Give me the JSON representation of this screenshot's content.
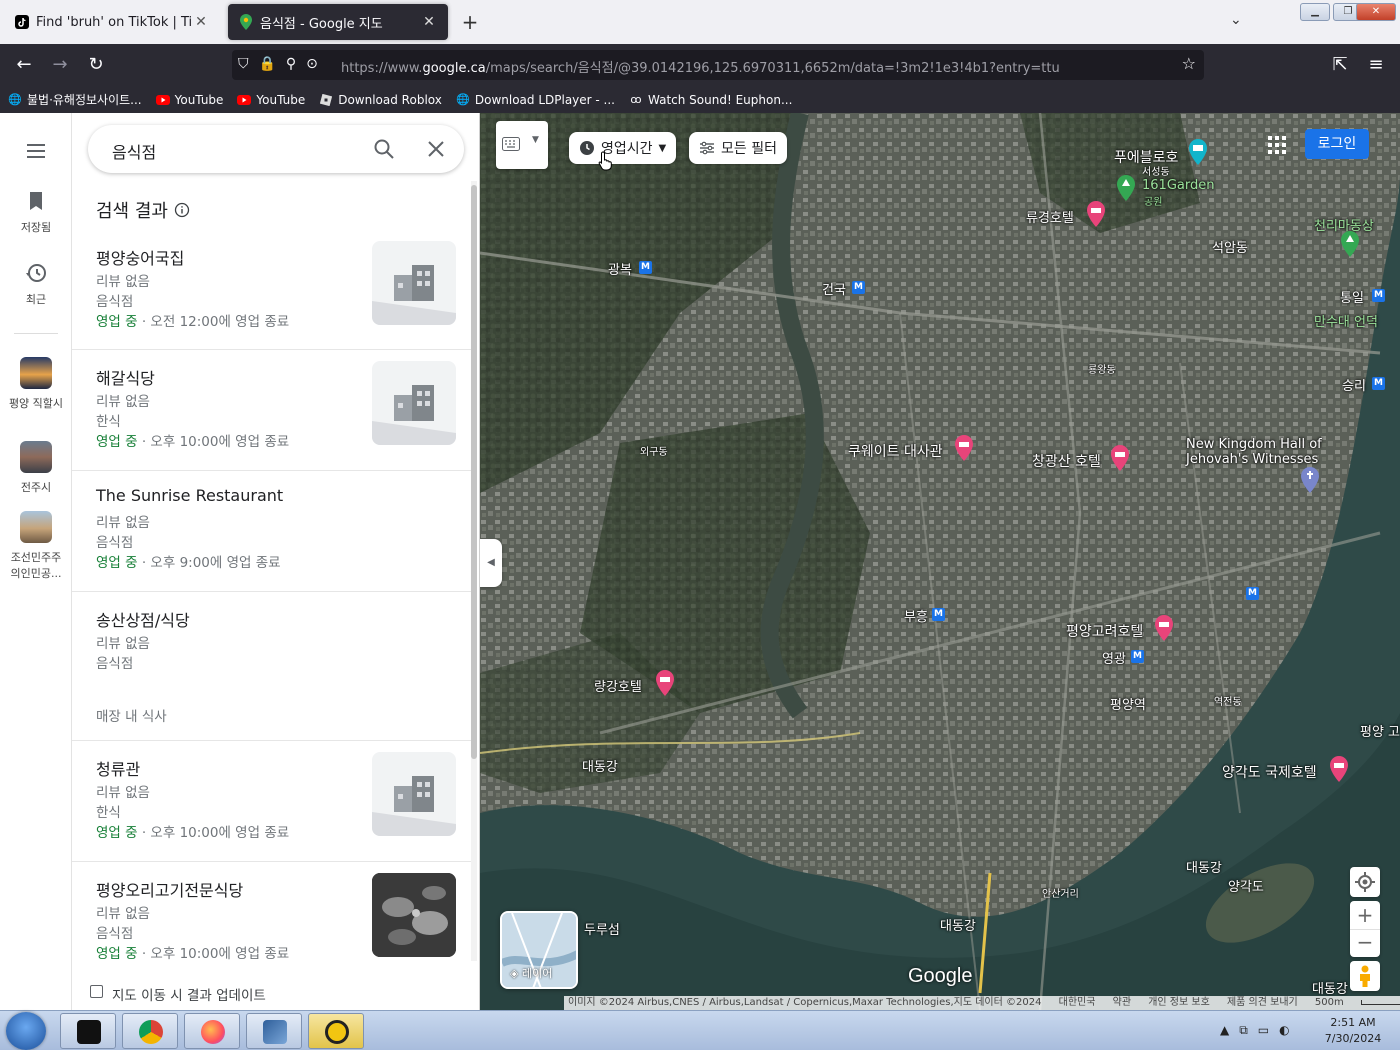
{
  "browser": {
    "tabs": [
      {
        "title": "Find 'bruh' on TikTok | TikTok S",
        "icon": "tiktok-icon",
        "active": false
      },
      {
        "title": "음식점 - Google 지도",
        "icon": "google-maps-icon",
        "active": true
      }
    ],
    "url": {
      "prefix": "https://www.",
      "domain": "google.ca",
      "path": "/maps/search/음식점/@39.0142196,125.6970311,6652m/data=!3m2!1e3!4b1?entry=ttu"
    },
    "bookmarks": [
      {
        "label": "불법·유해정보사이트...",
        "icon": "globe-icon"
      },
      {
        "label": "YouTube",
        "icon": "youtube-icon"
      },
      {
        "label": "YouTube",
        "icon": "youtube-icon"
      },
      {
        "label": "Download Roblox",
        "icon": "roblox-icon"
      },
      {
        "label": "Download LDPlayer - ...",
        "icon": "globe-icon"
      },
      {
        "label": "Watch Sound! Euphon...",
        "icon": "anime-icon"
      }
    ]
  },
  "rail": {
    "saved": "저장됨",
    "recent": "최근",
    "places": [
      {
        "label": "평양 직할시"
      },
      {
        "label": "전주시"
      },
      {
        "label": "조선민주주의인민공..."
      }
    ]
  },
  "panel": {
    "search_value": "음식점",
    "results_heading": "검색 결과",
    "results": [
      {
        "name": "평양숭어국집",
        "reviews": "리뷰 없음",
        "category": "음식점",
        "open": "영업 중",
        "hours": " · 오전 12:00에 영업 종료",
        "thumb": "placeholder"
      },
      {
        "name": "해갈식당",
        "reviews": "리뷰 없음",
        "category": "한식",
        "open": "영업 중",
        "hours": " · 오후 10:00에 영업 종료",
        "thumb": "placeholder"
      },
      {
        "name": "The Sunrise Restaurant",
        "reviews": "리뷰 없음",
        "category": "음식점",
        "open": "영업 중",
        "hours": " · 오후 9:00에 영업 종료",
        "thumb": "none"
      },
      {
        "name": "송산상점/식당",
        "reviews": "리뷰 없음",
        "category": "음식점",
        "extra": "매장 내 식사",
        "thumb": "none"
      },
      {
        "name": "청류관",
        "reviews": "리뷰 없음",
        "category": "한식",
        "open": "영업 중",
        "hours": " · 오후 10:00에 영업 종료",
        "thumb": "placeholder"
      },
      {
        "name": "평양오리고기전문식당",
        "reviews": "리뷰 없음",
        "category": "음식점",
        "open": "영업 중",
        "hours": " · 오후 10:00에 영업 종료",
        "thumb": "photo"
      }
    ],
    "update_on_move": "지도 이동 시 결과 업데이트"
  },
  "map": {
    "chips": {
      "hours": "영업시간",
      "filters": "모든 필터"
    },
    "login": "로그인",
    "layers": "레이어",
    "logo": "Google",
    "labels": {
      "pueblo": "푸에블로호",
      "songyo": "서성동",
      "garden": "161Garden",
      "park": "공원",
      "ryugyong": "류경호텔",
      "sogam": "석암동",
      "chollima": "천리마동상",
      "kwangbok": "광복",
      "konguk": "건국",
      "tongil": "통일",
      "mansudae": "만수대 언덕",
      "kuwait": "쿠웨이트 대사관",
      "changgwangsan": "창광산 호텔",
      "kingdom": "New Kingdom Hall of Jehovah's Witnesses",
      "sungni": "승리",
      "puhung": "부흥",
      "koryo": "평양고려호텔",
      "yonggwang": "영광",
      "pyongyang_station": "평양역",
      "ryanggang": "량강호텔",
      "taedong1": "대동강",
      "taedong2": "대동강",
      "taedong3": "대동강",
      "taedong_bottom": "대동강",
      "yanggakdo_hotel": "양각도 국제호텔",
      "yanggakdo": "양각도",
      "dudu": "두루섬",
      "pyongyang_right": "평양 고",
      "ryongwang": "룡왕동",
      "oegu": "외구동",
      "yokjon": "역전동",
      "ansan": "안산거리"
    },
    "attribution": [
      "이미지 ©2024 Airbus,CNES / Airbus,Landsat / Copernicus,Maxar Technologies,지도 데이터 ©2024",
      "대한민국",
      "약관",
      "개인 정보 보호",
      "제품 의견 보내기",
      "500m"
    ]
  },
  "taskbar": {
    "apps": [
      "terminal-icon",
      "chrome-icon",
      "firefox-icon",
      "virtualbox-icon",
      "ldplayer-icon"
    ],
    "time": "2:51 AM",
    "date": "7/30/2024"
  }
}
